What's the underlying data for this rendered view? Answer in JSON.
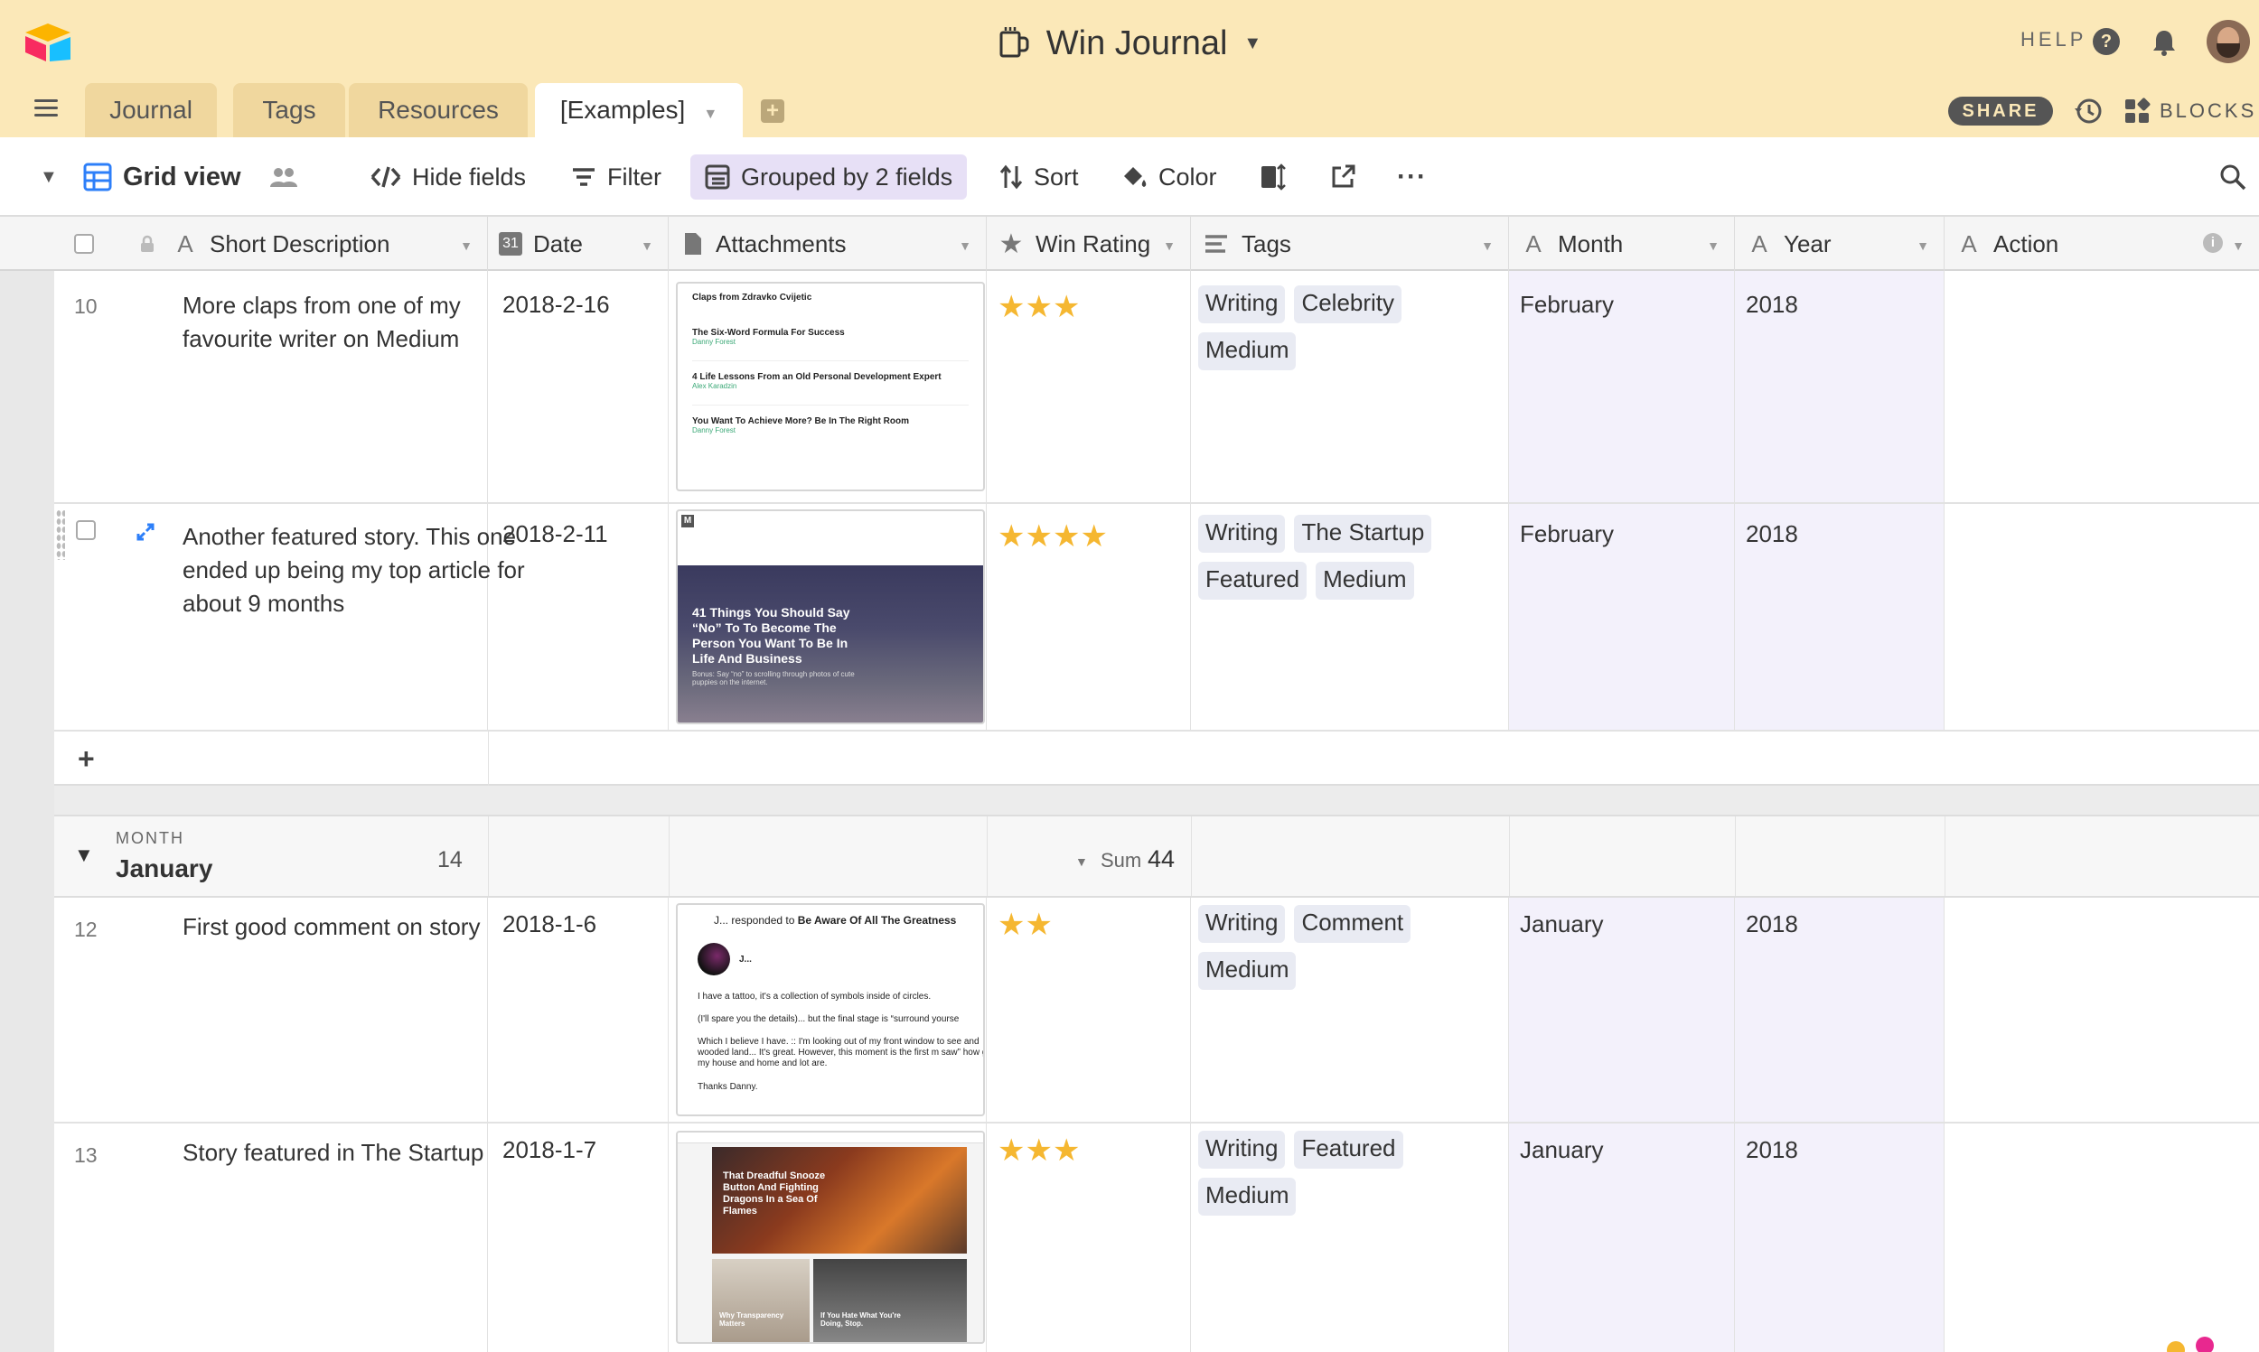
{
  "header": {
    "title": "Win Journal",
    "help_label": "HELP",
    "share_label": "SHARE",
    "blocks_label": "BLOCKS"
  },
  "tabs": [
    "Journal",
    "Tags",
    "Resources",
    "[Examples]"
  ],
  "toolbar": {
    "view_name": "Grid view",
    "hide_fields": "Hide fields",
    "filter": "Filter",
    "grouped": "Grouped by 2 fields",
    "sort": "Sort",
    "color": "Color"
  },
  "columns": [
    "Short Description",
    "Date",
    "Attachments",
    "Win Rating",
    "Tags",
    "Month",
    "Year",
    "Action"
  ],
  "colors": {
    "header_bg": "#fbe8b8",
    "tab_inactive": "#f0d79e",
    "star": "#f5b731",
    "grouped_bg": "#e7e0f6",
    "tag_bg": "#e9ebf3",
    "shaded_column": "#f3f1fb"
  },
  "rows_group1": [
    {
      "num": "10",
      "description": "More claps from one of my favourite writer on Medium",
      "date": "2018-2-16",
      "rating": 3,
      "stars": "★★★",
      "tags": [
        "Writing",
        "Celebrity",
        "Medium"
      ],
      "month": "February",
      "year": "2018",
      "attachment": {
        "heading": "Claps from Zdravko Cvijetic",
        "items": [
          {
            "title": "The Six-Word Formula For Success",
            "author": "Danny Forest"
          },
          {
            "title": "4 Life Lessons From an Old Personal Development Expert",
            "author": "Alex Karadzin"
          },
          {
            "title": "You Want To Achieve More? Be In The Right Room",
            "author": "Danny Forest"
          }
        ]
      }
    },
    {
      "num": "",
      "description": "Another featured story. This one ended up being my top article for about 9 months",
      "date": "2018-2-11",
      "rating": 4,
      "stars": "★★★★",
      "tags": [
        "Writing",
        "The Startup",
        "Featured",
        "Medium"
      ],
      "month": "February",
      "year": "2018",
      "attachment": {
        "headline": "41 Things You Should Say “No” To To Become The Person You Want To Be In Life And Business",
        "sub": "Bonus: Say “no” to scrolling through photos of cute puppies on the internet."
      }
    }
  ],
  "group2": {
    "label": "MONTH",
    "name": "January",
    "count": "14",
    "sum_label": "Sum",
    "sum_value": "44"
  },
  "rows_group2": [
    {
      "num": "12",
      "description": "First good comment on story",
      "date": "2018-1-6",
      "rating": 2,
      "stars": "★★",
      "tags": [
        "Writing",
        "Comment",
        "Medium"
      ],
      "month": "January",
      "year": "2018",
      "attachment": {
        "line1_prefix": "J... responded to",
        "line1_bold": "Be Aware Of All The Greatness",
        "user": "J...",
        "p1": "I have a tattoo, it's a collection of symbols inside of circles.",
        "p2": "(I'll spare you the details)... but the final stage is “surround yourse",
        "p3": "Which I believe I have. :: I'm looking out of my front window to see and wooded land... It's great. However, this moment is the first m saw” how great my house and home and lot are.",
        "p4": "Thanks Danny."
      }
    },
    {
      "num": "13",
      "description": "Story featured in The Startup",
      "date": "2018-1-7",
      "rating": 3,
      "stars": "★★★",
      "tags": [
        "Writing",
        "Featured",
        "Medium"
      ],
      "month": "January",
      "year": "2018",
      "attachment": {
        "headline": "That Dreadful Snooze Button And Fighting Dragons In a Sea Of Flames",
        "left_caption": "Why Transparency Matters",
        "right_caption": "If You Hate What You're Doing, Stop."
      }
    }
  ]
}
